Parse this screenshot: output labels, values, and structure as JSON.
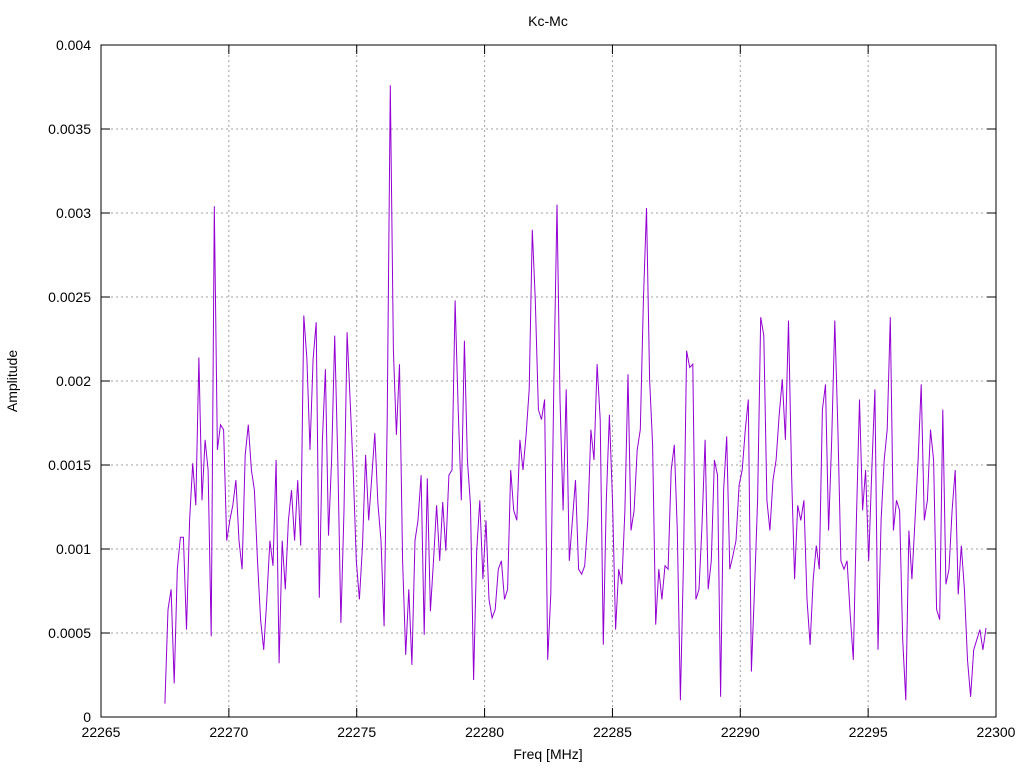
{
  "chart_data": {
    "type": "line",
    "title": "Kc-Mc",
    "xlabel": "Freq [MHz]",
    "ylabel": "Amplitude",
    "xlim": [
      22265,
      22300
    ],
    "ylim": [
      0,
      0.004
    ],
    "x_start": 22267.5,
    "x_end": 22299.61,
    "grid": true,
    "line_color": "#9400d3",
    "x_ticks": [
      "22265",
      "22270",
      "22275",
      "22280",
      "22285",
      "22290",
      "22295",
      "22300"
    ],
    "x_tick_values": [
      22265,
      22270,
      22275,
      22280,
      22285,
      22290,
      22295,
      22300
    ],
    "y_ticks": [
      "0",
      "0.0005",
      "0.001",
      "0.0015",
      "0.002",
      "0.0025",
      "0.003",
      "0.0035",
      "0.004"
    ],
    "y_tick_values": [
      0,
      0.0005,
      0.001,
      0.0015,
      0.002,
      0.0025,
      0.003,
      0.0035,
      0.004
    ],
    "series": [
      {
        "name": "Kc-Mc",
        "values": [
          8e-05,
          0.00064,
          0.00076,
          0.0002,
          0.00088,
          0.00107,
          0.00107,
          0.00052,
          0.00117,
          0.00151,
          0.00126,
          0.00214,
          0.00129,
          0.00165,
          0.00147,
          0.00048,
          0.00304,
          0.00159,
          0.00174,
          0.00171,
          0.00105,
          0.00117,
          0.00126,
          0.00141,
          0.00105,
          0.00088,
          0.00156,
          0.00174,
          0.00147,
          0.00135,
          0.00093,
          0.00058,
          0.0004,
          0.0007,
          0.00105,
          0.0009,
          0.00153,
          0.00032,
          0.00105,
          0.00076,
          0.00117,
          0.00135,
          0.00105,
          0.00141,
          0.00102,
          0.00239,
          0.00213,
          0.00159,
          0.00213,
          0.00235,
          0.00071,
          0.00165,
          0.00207,
          0.00108,
          0.00153,
          0.00227,
          0.00153,
          0.00056,
          0.00123,
          0.00229,
          0.00189,
          0.00147,
          0.00093,
          0.0007,
          0.00102,
          0.00156,
          0.00117,
          0.00142,
          0.00169,
          0.00127,
          0.00105,
          0.00054,
          0.00177,
          0.00376,
          0.00218,
          0.00168,
          0.0021,
          0.00093,
          0.00037,
          0.00076,
          0.00031,
          0.00105,
          0.00117,
          0.00144,
          0.00049,
          0.00142,
          0.00063,
          0.00093,
          0.00126,
          0.00093,
          0.00128,
          0.00099,
          0.00144,
          0.00147,
          0.00248,
          0.00183,
          0.00129,
          0.00224,
          0.00153,
          0.00126,
          0.00022,
          0.00099,
          0.00129,
          0.00082,
          0.00117,
          0.0007,
          0.00059,
          0.00064,
          0.00088,
          0.00093,
          0.0007,
          0.00076,
          0.00147,
          0.00123,
          0.00117,
          0.00165,
          0.00147,
          0.00168,
          0.00195,
          0.0029,
          0.00248,
          0.00183,
          0.00177,
          0.00189,
          0.00034,
          0.00073,
          0.00201,
          0.00305,
          0.00189,
          0.00123,
          0.00195,
          0.00093,
          0.00117,
          0.00141,
          0.00088,
          0.00085,
          0.0009,
          0.00117,
          0.00171,
          0.00153,
          0.0021,
          0.00177,
          0.00043,
          0.00129,
          0.0018,
          0.00129,
          0.00052,
          0.00088,
          0.00079,
          0.00123,
          0.00204,
          0.00111,
          0.00123,
          0.00159,
          0.00171,
          0.00248,
          0.00303,
          0.00201,
          0.00162,
          0.00055,
          0.00088,
          0.0007,
          0.0009,
          0.00088,
          0.00147,
          0.00162,
          0.00111,
          0.0001,
          0.00093,
          0.00218,
          0.00208,
          0.0021,
          0.0007,
          0.00076,
          0.00114,
          0.00165,
          0.00076,
          0.00093,
          0.00153,
          0.00144,
          0.00012,
          0.00135,
          0.00167,
          0.00088,
          0.00096,
          0.00105,
          0.00138,
          0.00147,
          0.00171,
          0.00189,
          0.00027,
          0.00076,
          0.00129,
          0.00238,
          0.00227,
          0.00129,
          0.00111,
          0.00141,
          0.00153,
          0.0018,
          0.00201,
          0.00165,
          0.00236,
          0.00144,
          0.00082,
          0.00126,
          0.00117,
          0.00129,
          0.0007,
          0.00043,
          0.00082,
          0.00102,
          0.00088,
          0.00183,
          0.00198,
          0.00111,
          0.00165,
          0.00236,
          0.00171,
          0.00093,
          0.00088,
          0.00093,
          0.00061,
          0.00034,
          0.00117,
          0.00189,
          0.00123,
          0.00147,
          0.00093,
          0.00147,
          0.00195,
          0.0004,
          0.00117,
          0.00153,
          0.00171,
          0.00238,
          0.00111,
          0.00129,
          0.00123,
          0.00046,
          0.0001,
          0.00111,
          0.00082,
          0.00117,
          0.00153,
          0.00198,
          0.00117,
          0.00129,
          0.00171,
          0.00153,
          0.00064,
          0.00058,
          0.00183,
          0.00079,
          0.00088,
          0.00123,
          0.00147,
          0.00073,
          0.00102,
          0.00076,
          0.00034,
          0.00012,
          0.0004,
          0.00046,
          0.00052,
          0.0004,
          0.00053
        ]
      }
    ]
  }
}
